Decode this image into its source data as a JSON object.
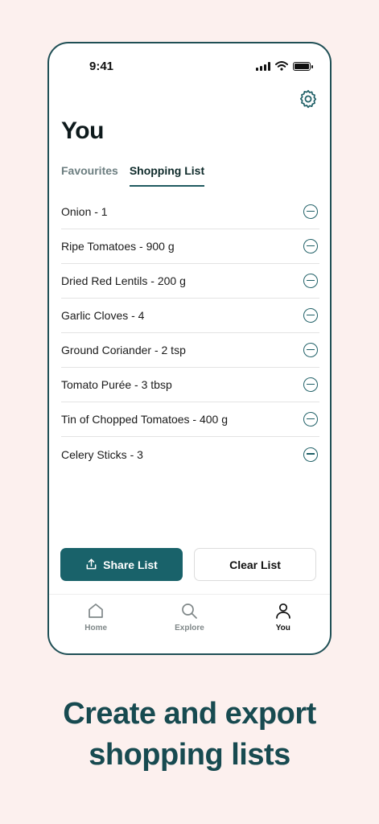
{
  "status_bar": {
    "time": "9:41"
  },
  "page": {
    "title": "You"
  },
  "tabs": [
    {
      "label": "Favourites",
      "active": false
    },
    {
      "label": "Shopping List",
      "active": true
    }
  ],
  "shopping_list": [
    "Onion - 1",
    "Ripe Tomatoes - 900 g",
    "Dried Red Lentils - 200 g",
    "Garlic Cloves - 4",
    "Ground Coriander - 2 tsp",
    "Tomato Purée - 3 tbsp",
    "Tin of Chopped Tomatoes - 400 g",
    "Celery Sticks - 3"
  ],
  "actions": {
    "share_label": "Share List",
    "clear_label": "Clear List"
  },
  "tabbar": [
    {
      "label": "Home",
      "icon": "home-icon",
      "active": false
    },
    {
      "label": "Explore",
      "icon": "search-icon",
      "active": false
    },
    {
      "label": "You",
      "icon": "user-icon",
      "active": true
    }
  ],
  "marketing": {
    "headline_line1": "Create and export",
    "headline_line2": "shopping lists"
  },
  "colors": {
    "accent": "#19626a",
    "background": "#fcf0ee",
    "headline": "#174a50"
  }
}
